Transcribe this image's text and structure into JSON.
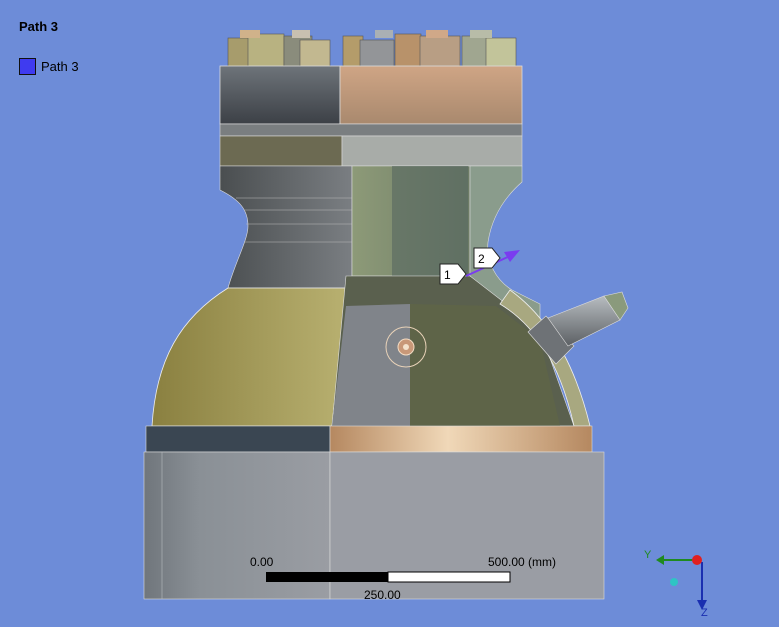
{
  "legend": {
    "title": "Path 3",
    "items": [
      {
        "label": "Path 3",
        "color": "#3f3bf0"
      }
    ]
  },
  "path_markers": {
    "start": "1",
    "end": "2"
  },
  "scale_bar": {
    "min_label": "0.00",
    "max_label": "500.00 (mm)",
    "mid_label": "250.00"
  },
  "triad": {
    "y_label": "Y",
    "z_label": "Z",
    "x_color": "#e02020",
    "y_color": "#1f8a1f",
    "z_color": "#1a2fb0"
  },
  "background_color": "#6d8cd8"
}
